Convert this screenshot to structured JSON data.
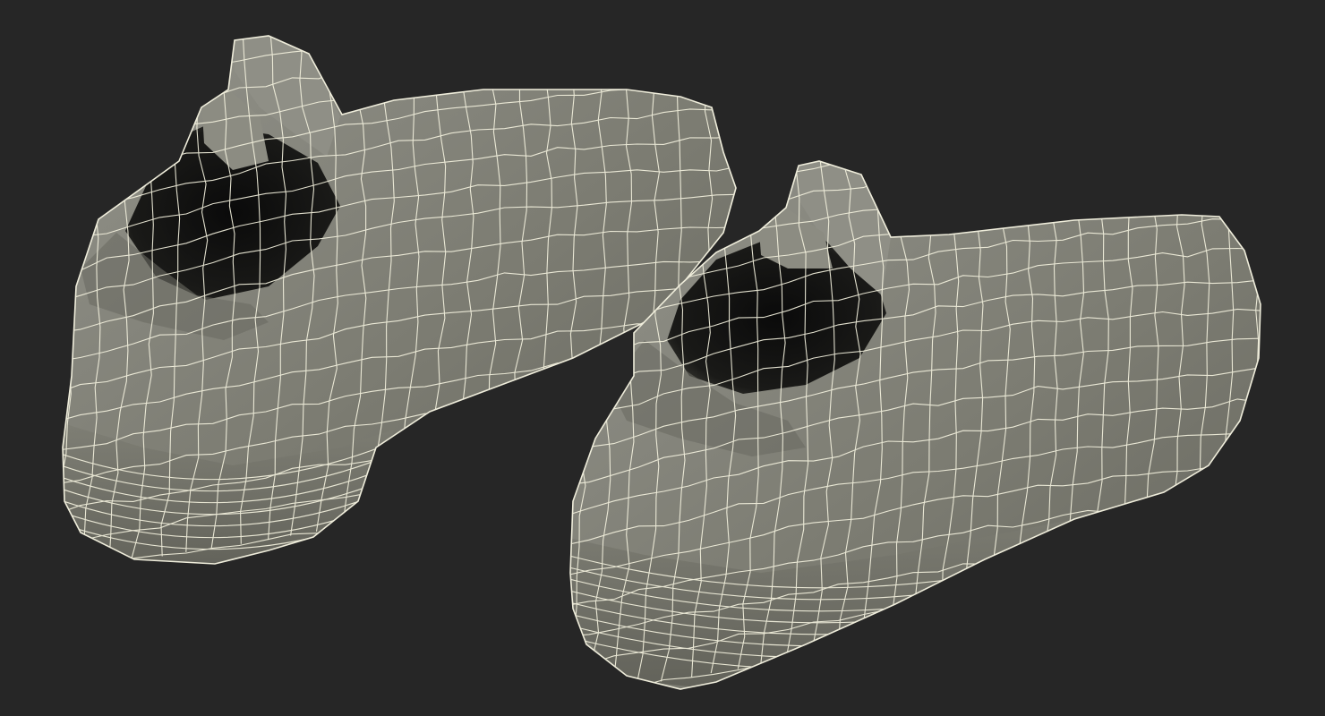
{
  "scene": {
    "background_color": "#262626",
    "mesh_fill_light": "#8a8a7c",
    "mesh_fill_mid": "#74746a",
    "mesh_fill_dark": "#55554d",
    "wire_color": "#f3f1de",
    "interior_color": "#101010",
    "objects": [
      {
        "name": "shoe-left"
      },
      {
        "name": "shoe-right"
      }
    ]
  }
}
